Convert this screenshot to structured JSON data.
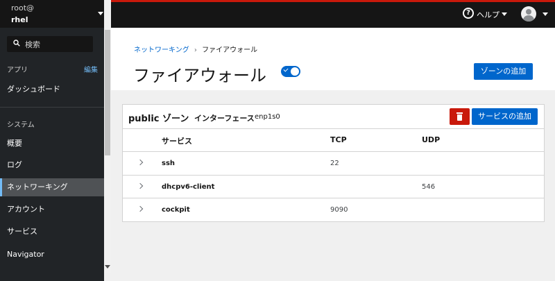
{
  "sidebar": {
    "host_user": "root@",
    "host_name": "rhel",
    "search_label": "検索",
    "apps_section": "アプリ",
    "edit_link": "編集",
    "dashboard": "ダッシュボード",
    "system_section": "システム",
    "items": [
      {
        "label": "概要"
      },
      {
        "label": "ログ"
      },
      {
        "label": "ネットワーキング",
        "active": true
      },
      {
        "label": "アカウント"
      },
      {
        "label": "サービス"
      },
      {
        "label": "Navigator"
      }
    ]
  },
  "masthead": {
    "help_label": "ヘルプ",
    "accent_color": "#c9190b"
  },
  "breadcrumb": {
    "parent": "ネットワーキング",
    "separator": "›",
    "current": "ファイアウォール"
  },
  "page": {
    "title": "ファイアウォール",
    "firewall_enabled": true,
    "add_zone_label": "ゾーンの追加"
  },
  "zone": {
    "title": "public ゾーン",
    "interfaces_label": "インターフェース",
    "interfaces_value": "enp1s0",
    "add_service_label": "サービスの追加",
    "columns": [
      "サービス",
      "TCP",
      "UDP"
    ],
    "rows": [
      {
        "service": "ssh",
        "tcp": "22",
        "udp": ""
      },
      {
        "service": "dhcpv6-client",
        "tcp": "",
        "udp": "546"
      },
      {
        "service": "cockpit",
        "tcp": "9090",
        "udp": ""
      }
    ]
  },
  "colors": {
    "primary": "#0066cc",
    "danger": "#c9190b",
    "sidebar_bg": "#212427",
    "masthead_bg": "#151515"
  }
}
